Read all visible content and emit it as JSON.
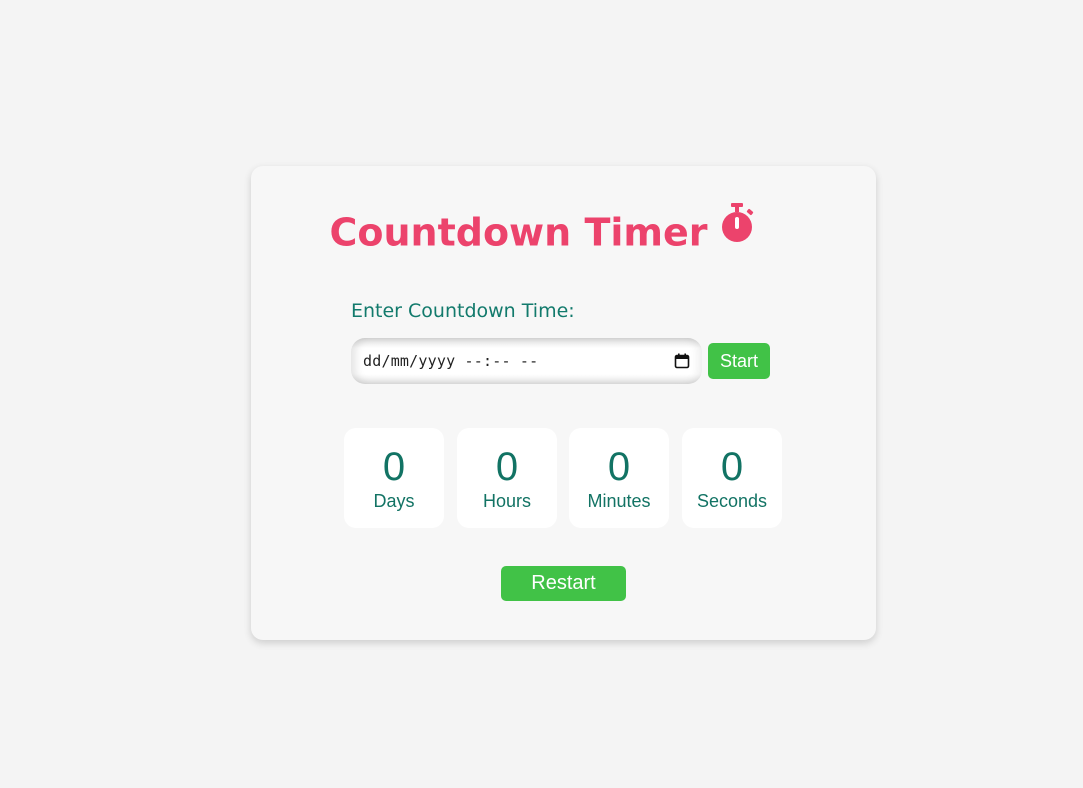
{
  "title": "Countdown Timer",
  "title_icon": "stopwatch-icon",
  "input": {
    "label": "Enter Countdown Time:",
    "placeholder": "dd/mm/yyyy --:-- --",
    "icon": "calendar-icon"
  },
  "buttons": {
    "start": "Start",
    "restart": "Restart"
  },
  "timer": [
    {
      "value": "0",
      "unit": "Days"
    },
    {
      "value": "0",
      "unit": "Hours"
    },
    {
      "value": "0",
      "unit": "Minutes"
    },
    {
      "value": "0",
      "unit": "Seconds"
    }
  ],
  "colors": {
    "title": "#ec436c",
    "accent_text": "#127a6c",
    "button": "#41c247",
    "background": "#f4f4f4",
    "card": "#f7f7f7"
  }
}
